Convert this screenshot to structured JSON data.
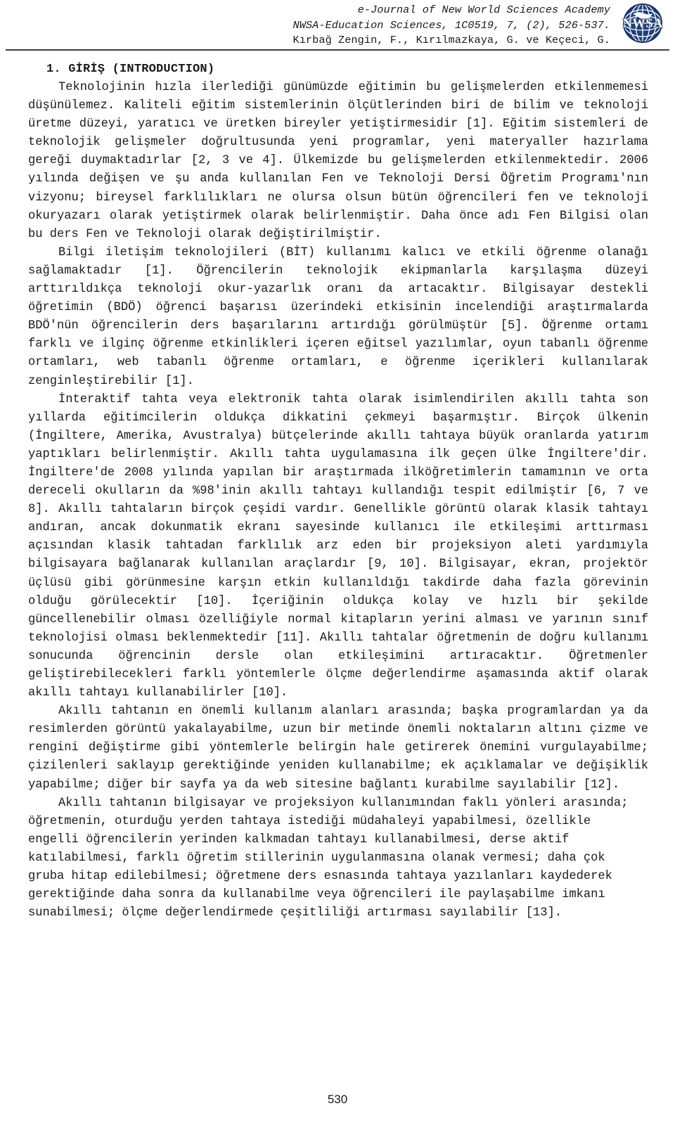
{
  "header": {
    "line1": "e-Journal of New World Sciences Academy",
    "line2": "NWSA-Education Sciences, 1C0519, 7, (2), 526-537.",
    "line3": "Kırbağ Zengin, F., Kırılmazkaya, G. ve Keçeci, G.",
    "logo_text": "NWSA",
    "logo_color": "#1f3f7a"
  },
  "section": {
    "heading": "1. GİRİŞ (INTRODUCTION)"
  },
  "paragraphs": [
    "Teknolojinin hızla ilerlediği günümüzde eğitimin bu gelişmelerden etkilenmemesi düşünülemez. Kaliteli eğitim sistemlerinin ölçütlerinden biri de bilim ve teknoloji üretme düzeyi, yaratıcı ve üretken bireyler yetiştirmesidir [1]. Eğitim sistemleri de teknolojik gelişmeler doğrultusunda yeni programlar, yeni materyaller hazırlama gereği duymaktadırlar [2, 3 ve 4]. Ülkemizde bu gelişmelerden etkilenmektedir. 2006 yılında değişen ve şu anda kullanılan Fen ve Teknoloji Dersi Öğretim Programı'nın vizyonu; bireysel farklılıkları ne olursa olsun bütün öğrencileri fen ve teknoloji okuryazarı olarak yetiştirmek olarak belirlenmiştir. Daha önce adı Fen Bilgisi olan bu ders Fen ve Teknoloji olarak değiştirilmiştir.",
    "Bilgi iletişim teknolojileri (BİT) kullanımı kalıcı ve etkili öğrenme olanağı sağlamaktadır [1]. Öğrencilerin teknolojik ekipmanlarla karşılaşma düzeyi arttırıldıkça teknoloji okur-yazarlık oranı da artacaktır. Bilgisayar destekli öğretimin (BDÖ) öğrenci başarısı üzerindeki etkisinin incelendiği araştırmalarda BDÖ'nün öğrencilerin ders başarılarını artırdığı görülmüştür [5]. Öğrenme ortamı farklı ve ilginç öğrenme etkinlikleri içeren eğitsel yazılımlar, oyun tabanlı öğrenme ortamları, web tabanlı öğrenme ortamları, e öğrenme içerikleri kullanılarak zenginleştirebilir [1].",
    "İnteraktif tahta veya elektronik tahta olarak isimlendirilen akıllı tahta son yıllarda eğitimcilerin oldukça dikkatini çekmeyi başarmıştır. Birçok ülkenin (İngiltere, Amerika, Avustralya) bütçelerinde akıllı tahtaya büyük oranlarda yatırım yaptıkları belirlenmiştir. Akıllı tahta uygulamasına ilk geçen ülke İngiltere'dir. İngiltere'de 2008 yılında yapılan bir araştırmada ilköğretimlerin tamamının ve orta dereceli okulların da %98'inin akıllı tahtayı kullandığı tespit edilmiştir [6, 7 ve 8]. Akıllı tahtaların birçok çeşidi vardır. Genellikle görüntü olarak klasik tahtayı andıran, ancak dokunmatik ekranı sayesinde kullanıcı ile etkileşimi arttırması açısından klasik tahtadan farklılık arz eden bir projeksiyon aleti yardımıyla bilgisayara bağlanarak kullanılan araçlardır [9, 10]. Bilgisayar, ekran, projektör üçlüsü gibi görünmesine karşın etkin kullanıldığı takdirde daha fazla görevinin olduğu görülecektir [10]. İçeriğinin oldukça kolay ve hızlı bir şekilde güncellenebilir olması özelliğiyle normal kitapların yerini alması ve yarının sınıf teknolojisi olması beklenmektedir [11]. Akıllı tahtalar öğretmenin de doğru kullanımı sonucunda öğrencinin dersle olan etkileşimini artıracaktır. Öğretmenler geliştirebilecekleri farklı yöntemlerle ölçme değerlendirme aşamasında aktif olarak akıllı tahtayı kullanabilirler [10].",
    "Akıllı tahtanın en önemli kullanım alanları arasında; başka programlardan ya da resimlerden görüntü yakalayabilme, uzun bir metinde önemli noktaların altını çizme ve rengini değiştirme gibi yöntemlerle belirgin hale getirerek önemini vurgulayabilme; çizilenleri saklayıp gerektiğinde yeniden kullanabilme; ek açıklamalar ve değişiklik yapabilme; diğer bir sayfa ya da web sitesine bağlantı kurabilme sayılabilir [12].",
    "Akıllı tahtanın bilgisayar ve projeksiyon kullanımından faklı yönleri arasında; öğretmenin, oturduğu yerden tahtaya istediği müdahaleyi yapabilmesi, özellikle engelli öğrencilerin yerinden kalkmadan tahtayı kullanabilmesi, derse aktif katılabilmesi, farklı öğretim stillerinin uygulanmasına olanak vermesi; daha çok gruba hitap edilebilmesi; öğretmene ders esnasında tahtaya yazılanları kaydederek gerektiğinde daha sonra da kullanabilme veya öğrencileri ile paylaşabilme imkanı sunabilmesi; ölçme değerlendirmede çeşitliliği artırması sayılabilir [13]."
  ],
  "footer": {
    "page_number": "530"
  }
}
